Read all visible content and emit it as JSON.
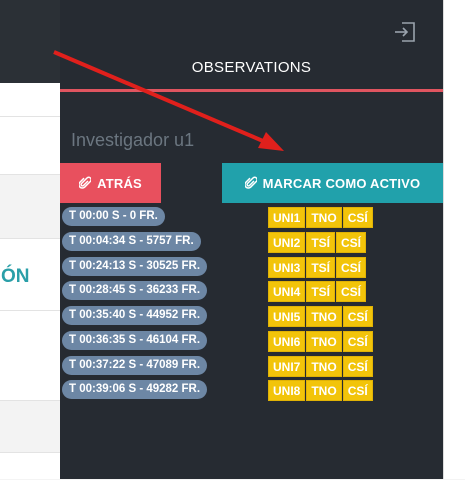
{
  "left_page": {
    "accent_text": "ÓN"
  },
  "panel": {
    "title": "OBSERVATIONS",
    "investigator": "Investigador u1",
    "back_button": "ATRÁS",
    "mark_active_button": "MARCAR COMO ACTIVO",
    "icons": {
      "exit": "exit-icon",
      "clip": "paperclip-icon"
    },
    "colors": {
      "back": "#e8505e",
      "active": "#21a1ab",
      "title_rule": "#e05560",
      "pill": "#6d87a5",
      "tag": "#f2c40a"
    }
  },
  "observations": [
    {
      "time": "T 00:00 S - 0 FR.",
      "tags": [
        "UNI1",
        "TNO",
        "CSÍ"
      ]
    },
    {
      "time": "T 00:04:34 S - 5757 FR.",
      "tags": [
        "UNI2",
        "TSÍ",
        "CSÍ"
      ]
    },
    {
      "time": "T 00:24:13 S - 30525 FR.",
      "tags": [
        "UNI3",
        "TSÍ",
        "CSÍ"
      ]
    },
    {
      "time": "T 00:28:45 S - 36233 FR.",
      "tags": [
        "UNI4",
        "TSÍ",
        "CSÍ"
      ]
    },
    {
      "time": "T 00:35:40 S - 44952 FR.",
      "tags": [
        "UNI5",
        "TNO",
        "CSÍ"
      ]
    },
    {
      "time": "T 00:36:35 S - 46104 FR.",
      "tags": [
        "UNI6",
        "TNO",
        "CSÍ"
      ]
    },
    {
      "time": "T 00:37:22 S - 47089 FR.",
      "tags": [
        "UNI7",
        "TNO",
        "CSÍ"
      ]
    },
    {
      "time": "T 00:39:06 S - 49282 FR.",
      "tags": [
        "UNI8",
        "TNO",
        "CSÍ"
      ]
    }
  ]
}
